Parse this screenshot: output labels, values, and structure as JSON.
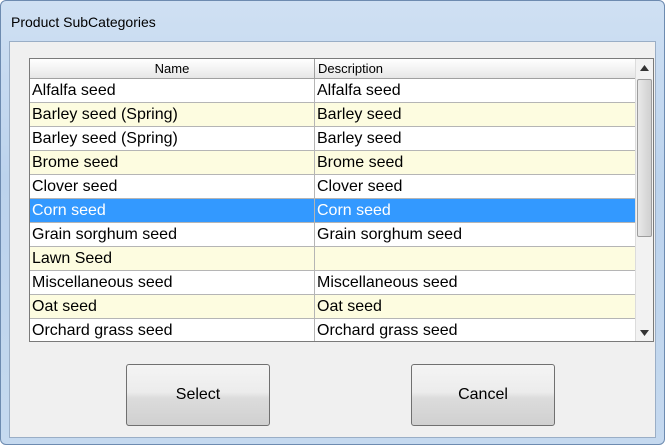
{
  "window": {
    "title": "Product SubCategories"
  },
  "grid": {
    "columns": [
      "Name",
      "Description"
    ],
    "rows": [
      {
        "name": "Alfalfa seed",
        "description": "Alfalfa seed"
      },
      {
        "name": "Barley seed (Spring)",
        "description": "Barley seed"
      },
      {
        "name": "Barley seed (Spring)",
        "description": "Barley seed"
      },
      {
        "name": "Brome seed",
        "description": "Brome seed"
      },
      {
        "name": "Clover seed",
        "description": "Clover seed"
      },
      {
        "name": "Corn seed",
        "description": "Corn seed"
      },
      {
        "name": "Grain sorghum seed",
        "description": "Grain sorghum seed"
      },
      {
        "name": "Lawn Seed",
        "description": ""
      },
      {
        "name": "Miscellaneous seed",
        "description": "Miscellaneous seed"
      },
      {
        "name": "Oat seed",
        "description": "Oat seed"
      },
      {
        "name": "Orchard grass seed",
        "description": "Orchard grass seed"
      }
    ],
    "selected_index": 5
  },
  "buttons": {
    "select_label": "Select",
    "cancel_label": "Cancel"
  },
  "icons": {
    "scroll_up": "triangle-up-icon",
    "scroll_down": "triangle-down-icon"
  },
  "colors": {
    "selection": "#3399ff",
    "alt_row": "#fdfce0"
  }
}
